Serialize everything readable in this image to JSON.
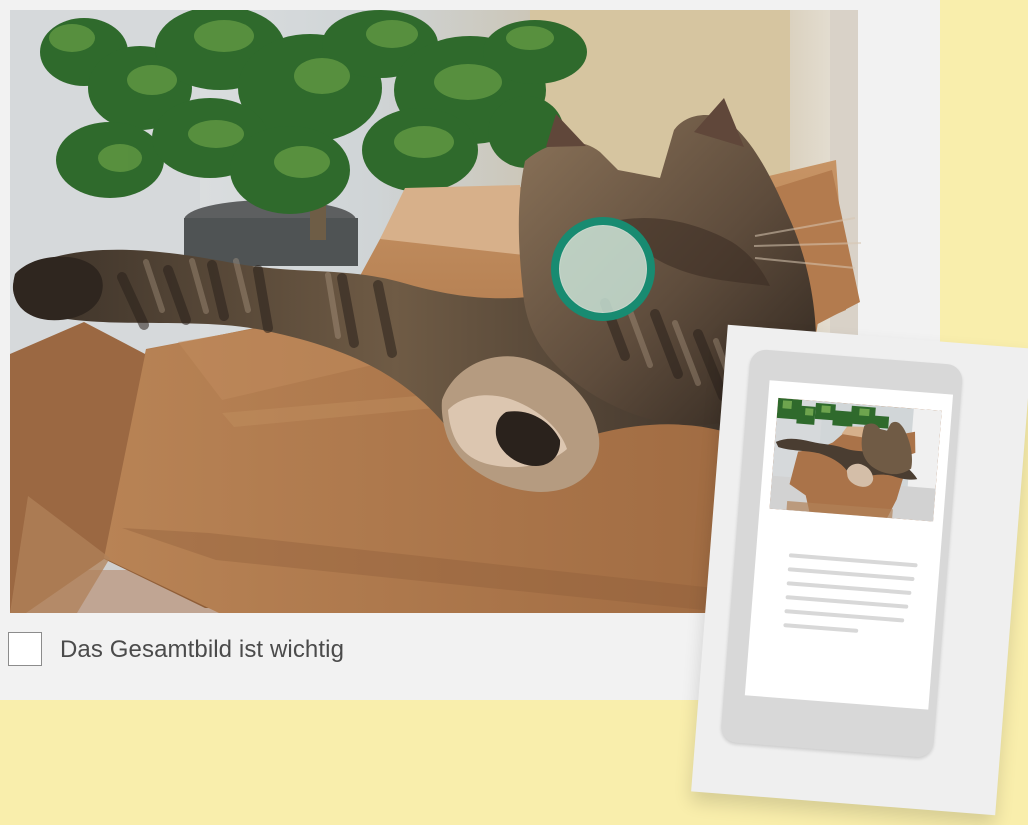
{
  "checkbox": {
    "label": "Das Gesamtbild ist wichtig",
    "checked": false
  },
  "icons": {
    "checkbox": "checkbox-unchecked-icon",
    "focus": "focus-point-icon",
    "mobile_preview": "mobile-preview-icon"
  },
  "colors": {
    "background": "#f9eeac",
    "card": "#f2f2f2",
    "focus_ring": "#188b71",
    "focus_fill": "#cde8dc",
    "checkbox_border": "#8c8c8c",
    "label_text": "#4b4b4b"
  }
}
